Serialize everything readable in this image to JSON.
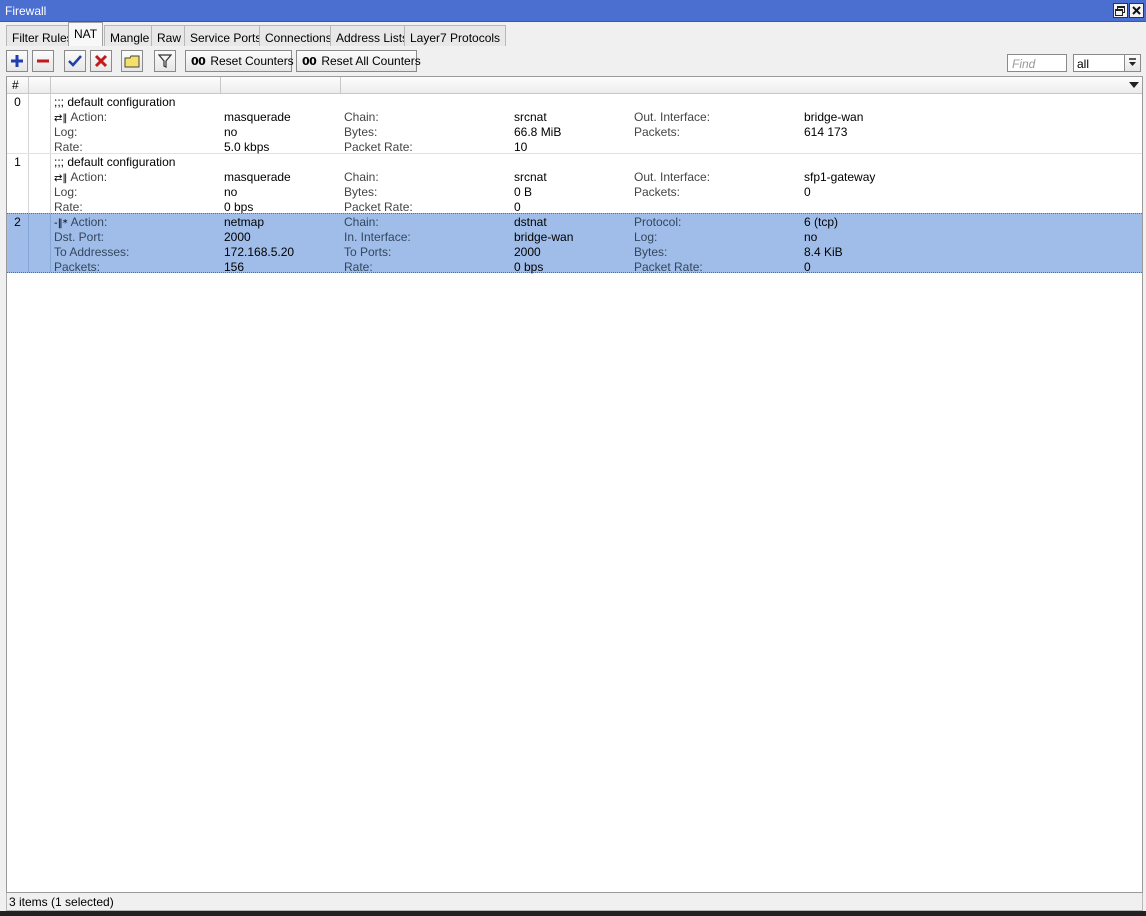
{
  "window": {
    "title": "Firewall"
  },
  "tabs": [
    {
      "label": "Filter Rules"
    },
    {
      "label": "NAT"
    },
    {
      "label": "Mangle"
    },
    {
      "label": "Raw"
    },
    {
      "label": "Service Ports"
    },
    {
      "label": "Connections"
    },
    {
      "label": "Address Lists"
    },
    {
      "label": "Layer7 Protocols"
    }
  ],
  "active_tab": "NAT",
  "toolbar": {
    "reset_counters": "Reset Counters",
    "reset_all_counters": "Reset All Counters",
    "counter_icon": "00",
    "find_placeholder": "Find",
    "filter_value": "all"
  },
  "table": {
    "header_num": "#",
    "rows": [
      {
        "num": "0",
        "comment": ";;; default configuration",
        "lines": [
          [
            [
              "Action:",
              "masquerade"
            ],
            [
              "Chain:",
              "srcnat"
            ],
            [
              "Out. Interface:",
              "bridge-wan"
            ]
          ],
          [
            [
              "Log:",
              "no"
            ],
            [
              "Bytes:",
              "66.8 MiB"
            ],
            [
              "Packets:",
              "614 173"
            ]
          ],
          [
            [
              "Rate:",
              "5.0 kbps"
            ],
            [
              "Packet Rate:",
              "10"
            ]
          ]
        ]
      },
      {
        "num": "1",
        "comment": ";;; default configuration",
        "lines": [
          [
            [
              "Action:",
              "masquerade"
            ],
            [
              "Chain:",
              "srcnat"
            ],
            [
              "Out. Interface:",
              "sfp1-gateway"
            ]
          ],
          [
            [
              "Log:",
              "no"
            ],
            [
              "Bytes:",
              "0 B"
            ],
            [
              "Packets:",
              "0"
            ]
          ],
          [
            [
              "Rate:",
              "0 bps"
            ],
            [
              "Packet Rate:",
              "0"
            ]
          ]
        ]
      },
      {
        "num": "2",
        "selected": true,
        "lines": [
          [
            [
              "Action:",
              "netmap"
            ],
            [
              "Chain:",
              "dstnat"
            ],
            [
              "Protocol:",
              "6 (tcp)"
            ]
          ],
          [
            [
              "Dst. Port:",
              "2000"
            ],
            [
              "In. Interface:",
              "bridge-wan"
            ],
            [
              "Log:",
              "no"
            ]
          ],
          [
            [
              "To Addresses:",
              "172.168.5.20"
            ],
            [
              "To Ports:",
              "2000"
            ],
            [
              "Bytes:",
              "8.4 KiB"
            ]
          ],
          [
            [
              "Packets:",
              "156"
            ],
            [
              "Rate:",
              "0 bps"
            ],
            [
              "Packet Rate:",
              "0"
            ]
          ]
        ]
      }
    ]
  },
  "status": {
    "text": "3 items (1 selected)"
  },
  "colors": {
    "titlebar": "#4a6fd1",
    "selection": "#9fbde8"
  }
}
